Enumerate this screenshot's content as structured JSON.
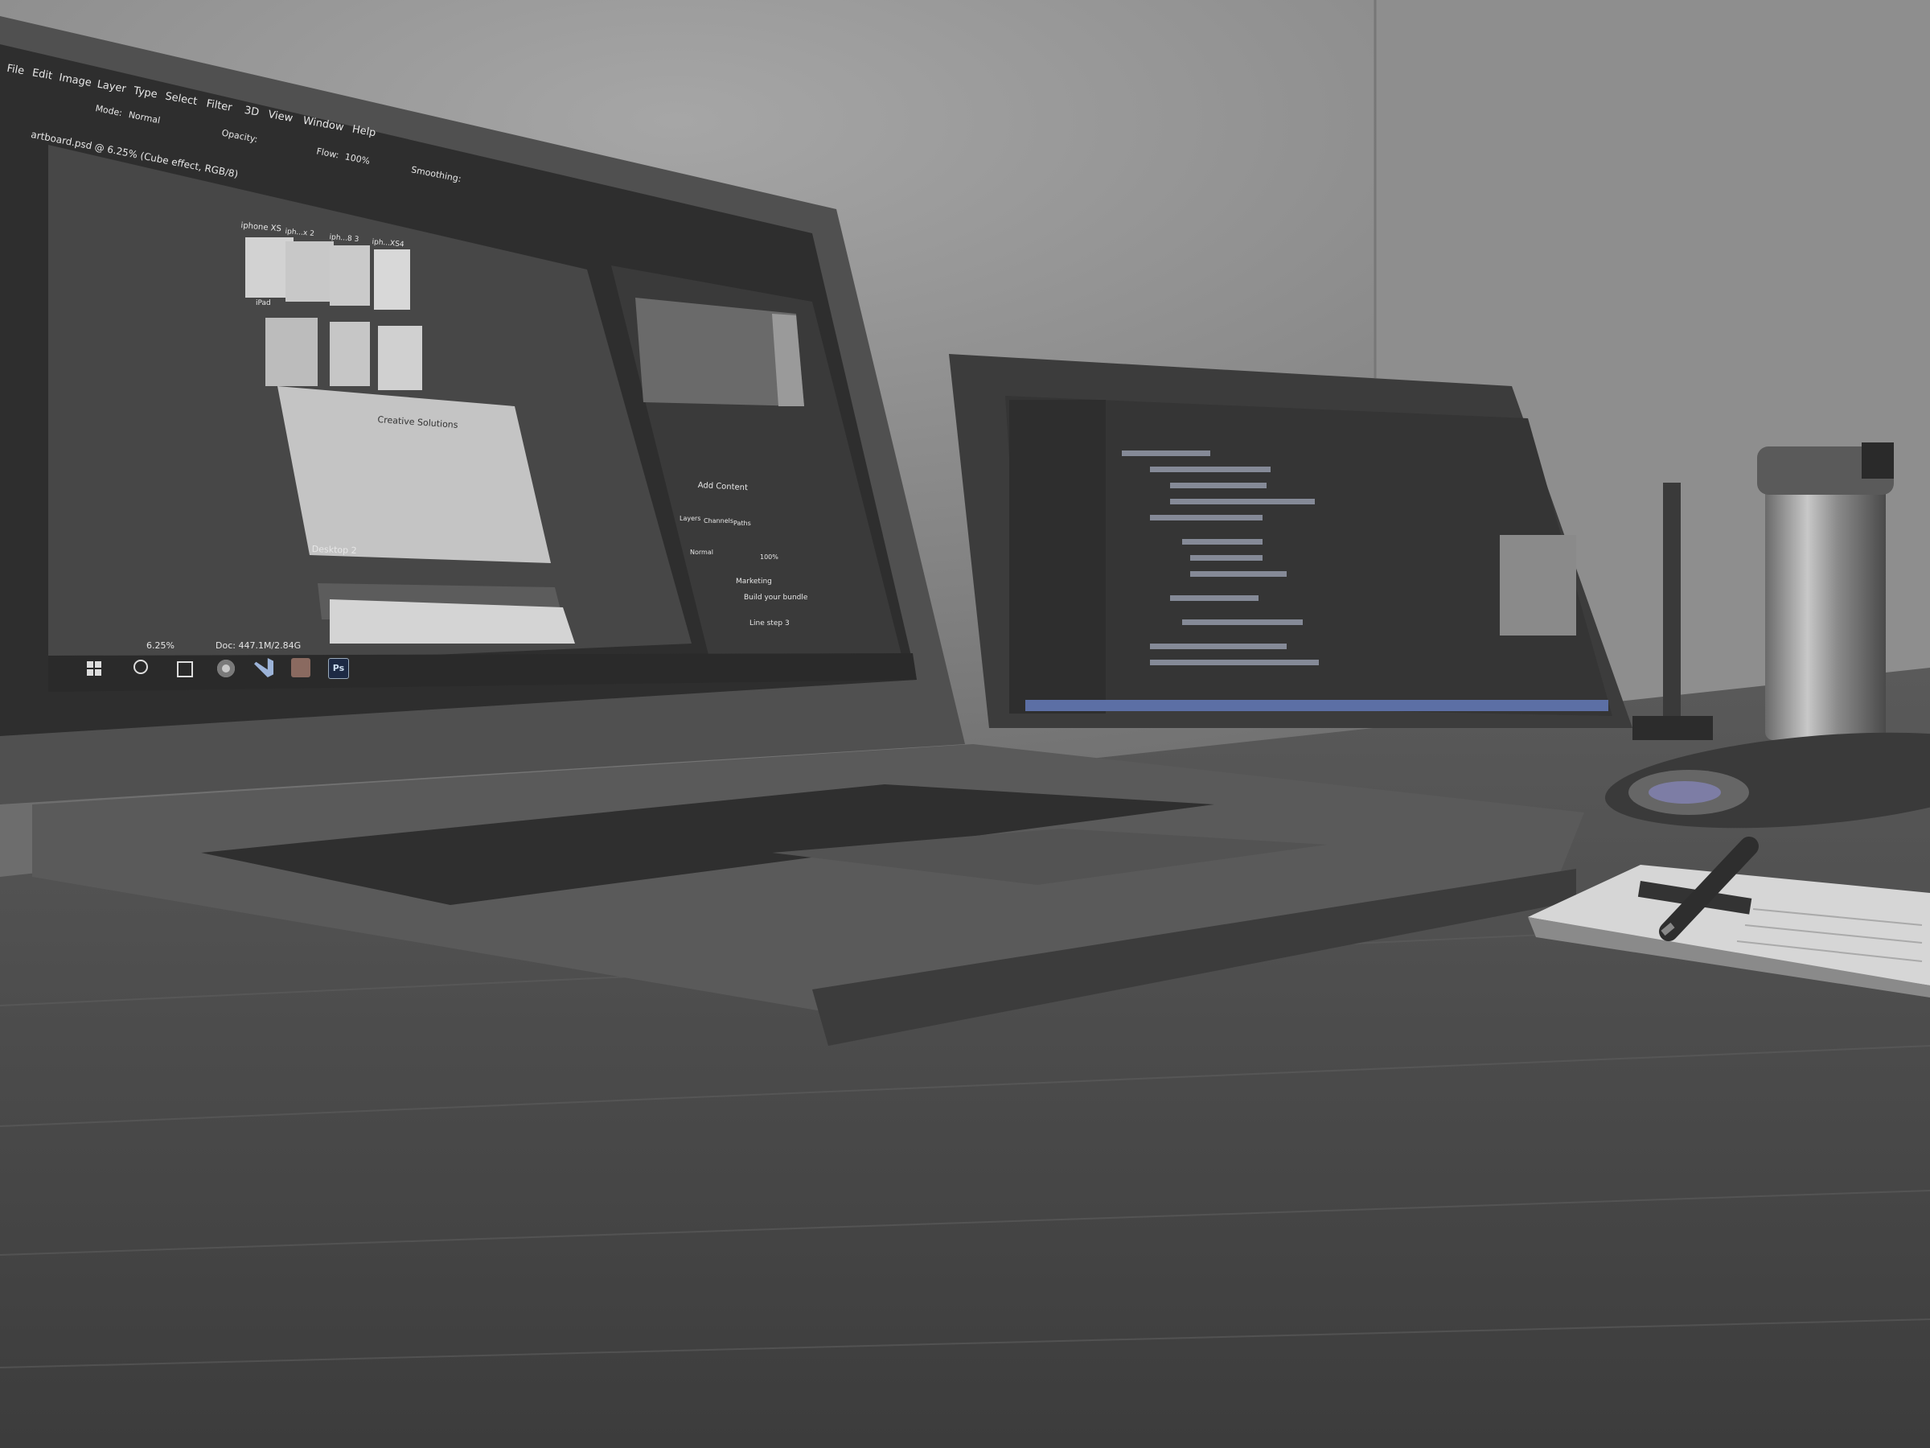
{
  "photo_subject": "laptop-and-monitor-on-desk",
  "photoshop": {
    "menu": [
      "File",
      "Edit",
      "Image",
      "Layer",
      "Type",
      "Select",
      "Filter",
      "3D",
      "View",
      "Window",
      "Help"
    ],
    "options_mode_label": "Mode:",
    "options_mode_value": "Normal",
    "options_opacity_label": "Opacity:",
    "options_flow_label": "Flow:",
    "options_flow_value": "100%",
    "options_smoothing_label": "Smoothing:",
    "document_tab": "artboard.psd @ 6.25% (Cube effect, RGB/8)",
    "artboard_labels": [
      "iphone XS",
      "iph...x 2",
      "iph...8 3",
      "iph...XS4",
      "iPad",
      "Desktop 2"
    ],
    "canvas_heading": "Creative Solutions",
    "properties_button": "Add Content",
    "layers_panel_tabs": [
      "Layers",
      "Channels",
      "Paths"
    ],
    "layers_blend": "Normal",
    "layers_opacity": "100%",
    "layer_names": [
      "Marketing",
      "Build your bundle",
      "Line step 3"
    ],
    "status_zoom": "6.25%",
    "status_doc": "Doc: 447.1M/2.84G"
  },
  "taskbar": {
    "app_icons": [
      "windows-start-icon",
      "search-icon",
      "task-view-icon",
      "chrome-icon",
      "vscode-icon",
      "xampp-icon",
      "photoshop-icon"
    ],
    "photoshop_label": "Ps"
  },
  "colors": {
    "wall": "#8a8a8a",
    "desk": "#4a4a4a",
    "laptop_body": "#5a5a5a",
    "screen_dark": "#3a3a3a",
    "code_bg": "#333333",
    "editor_status_bar": "#5c6fa5"
  }
}
